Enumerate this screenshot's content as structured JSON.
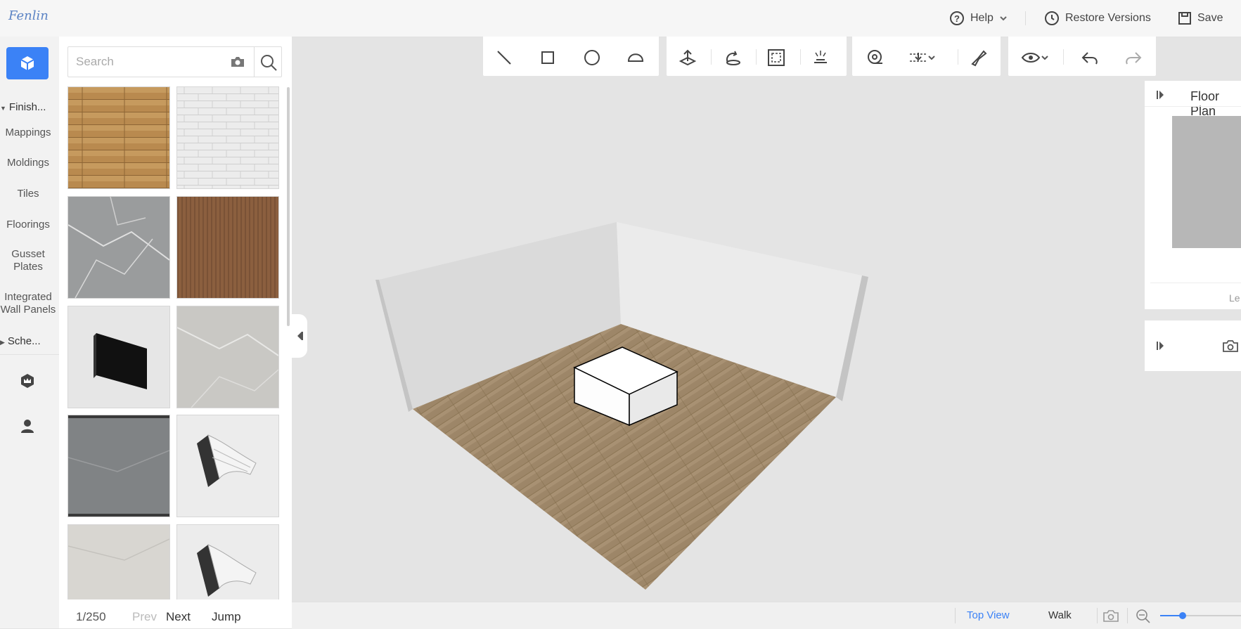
{
  "app": {
    "logo_text": "Fenlin"
  },
  "topbar": {
    "help_label": "Help",
    "restore_label": "Restore Versions",
    "save_label": "Save"
  },
  "leftnav": {
    "section_finish": "Finish...",
    "items": [
      "Mappings",
      "Moldings",
      "Tiles",
      "Floorings"
    ],
    "item_gusset": [
      "Gusset",
      "Plates"
    ],
    "item_panels": [
      "Integrated",
      "Wall Panels"
    ],
    "section_scheme": "Sche..."
  },
  "catalog": {
    "search_placeholder": "Search",
    "thumbnails": [
      {
        "name": "wood-brick-texture"
      },
      {
        "name": "white-brick-texture"
      },
      {
        "name": "grey-marble-texture"
      },
      {
        "name": "walnut-wood-texture"
      },
      {
        "name": "black-panel-model"
      },
      {
        "name": "light-marble-texture"
      },
      {
        "name": "dark-marble-tile"
      },
      {
        "name": "crown-molding-model"
      },
      {
        "name": "beige-marble-texture"
      },
      {
        "name": "crown-molding-model-2"
      }
    ],
    "pager": {
      "page": "1/250",
      "prev": "Prev",
      "next": "Next",
      "jump": "Jump"
    }
  },
  "right_panel": {
    "title": "Floor Plan",
    "legend_text": "Le"
  },
  "bottombar": {
    "top_view": "Top View",
    "walk": "Walk"
  },
  "colors": {
    "accent": "#3b82f6",
    "floor": "#9c8466",
    "wall": "#dcdcdc"
  }
}
